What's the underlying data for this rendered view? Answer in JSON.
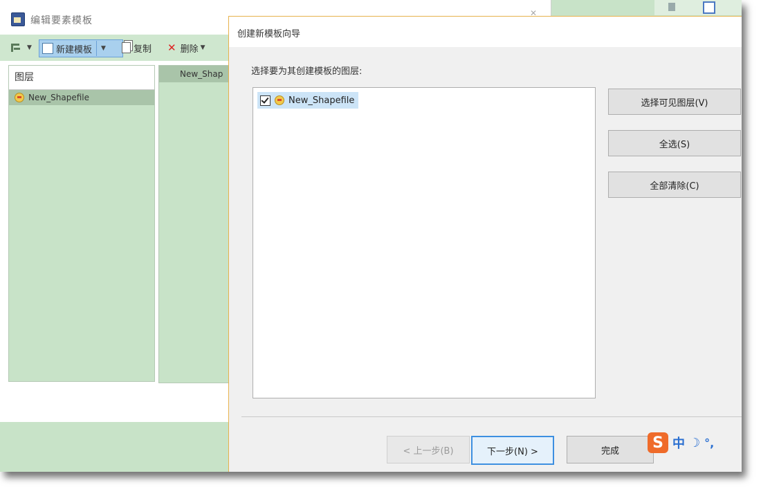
{
  "background_window": {
    "title": "编辑要素模板",
    "toolbar": {
      "new_template": "新建模板",
      "copy": "复制",
      "delete": "删除"
    },
    "layers_panel": {
      "header": "图层",
      "selected_item": "New_Shapefile"
    },
    "templates_panel": {
      "item": "New_Shap"
    }
  },
  "wizard": {
    "title": "创建新模板向导",
    "prompt": "选择要为其创建模板的图层:",
    "layers": [
      {
        "label": "New_Shapefile",
        "checked": true
      }
    ],
    "buttons": {
      "select_visible": "选择可见图层(V)",
      "select_all": "全选(S)",
      "clear_all": "全部清除(C)",
      "back": "< 上一步(B)",
      "next": "下一步(N) >",
      "finish": "完成"
    }
  },
  "ime": {
    "logo": "S",
    "mode": "中",
    "moon": "☽",
    "punct": "°,"
  },
  "colors": {
    "accent": "#3d8fe0",
    "selection": "#cce4f7",
    "panel_bg": "#c8e3c8",
    "ime_orange": "#ef6b2a"
  }
}
